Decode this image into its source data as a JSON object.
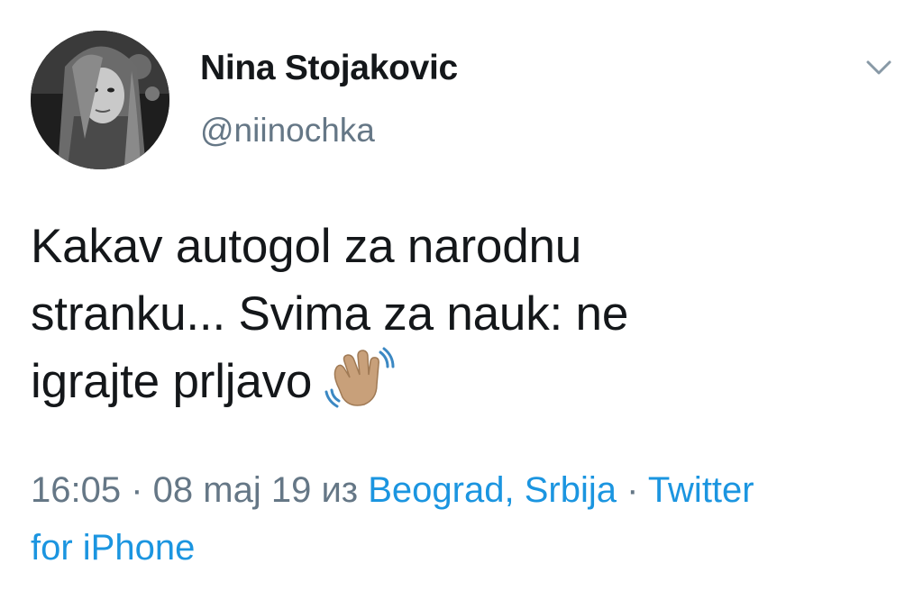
{
  "user": {
    "display_name": "Nina Stojakovic",
    "handle": "@niinochka",
    "avatar_icon": "profile-photo"
  },
  "menu": {
    "caret_icon": "chevron-down-icon"
  },
  "tweet": {
    "lines": [
      "Kakav autogol za narodnu",
      "stranku... Svima za nauk: ne",
      "igrajte prljavo"
    ],
    "emoji": "waving-hand-medium-skin-tone"
  },
  "meta": {
    "time": "16:05",
    "separator": " · ",
    "date": "08 maj 19",
    "from_label": " из ",
    "location": "Beograd, Srbija",
    "source_part1": "Twitter",
    "source_part2": "for iPhone"
  },
  "colors": {
    "text": "#14171a",
    "secondary": "#657786",
    "link": "#1b95e0"
  }
}
